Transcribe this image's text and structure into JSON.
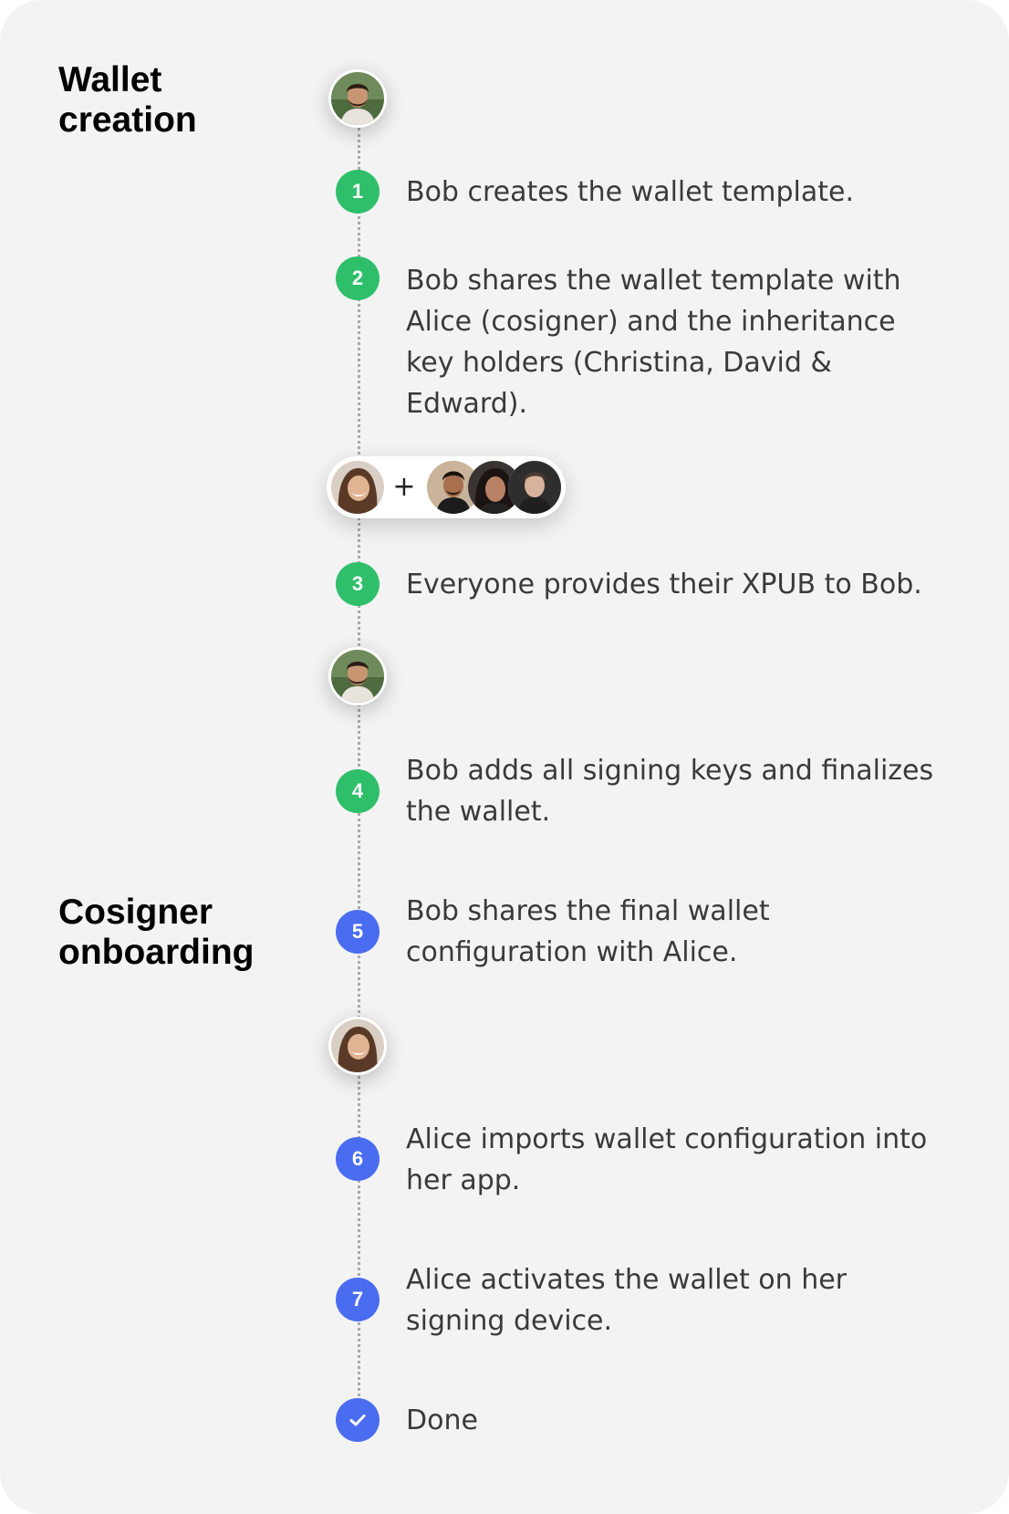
{
  "sections": {
    "wallet_creation": "Wallet\ncreation",
    "cosigner_onboarding": "Cosigner\nonboarding"
  },
  "steps": [
    {
      "badge": "1",
      "text": "Bob creates the wallet template.",
      "color": "#2fbf6b"
    },
    {
      "badge": "2",
      "text": "Bob shares the wallet template with Alice (cosigner) and the inheritance key holders (Christina, David & Edward).",
      "color": "#2fbf6b"
    },
    {
      "badge": "3",
      "text": "Everyone provides their XPUB to Bob.",
      "color": "#2fbf6b"
    },
    {
      "badge": "4",
      "text": "Bob adds all signing keys and finalizes the wallet.",
      "color": "#2fbf6b"
    },
    {
      "badge": "5",
      "text": "Bob shares the final wallet configuration with Alice.",
      "color": "#4a6cf0"
    },
    {
      "badge": "6",
      "text": "Alice imports wallet configuration into her app.",
      "color": "#4a6cf0"
    },
    {
      "badge": "7",
      "text": "Alice activates the wallet on her signing device.",
      "color": "#4a6cf0"
    }
  ],
  "done": {
    "icon": "check-icon",
    "text": "Done",
    "color": "#4a6cf0"
  },
  "group": {
    "plus": "+"
  },
  "avatars": [
    "bob-avatar",
    "alice-avatar",
    "christina-avatar",
    "david-avatar",
    "edward-avatar"
  ]
}
